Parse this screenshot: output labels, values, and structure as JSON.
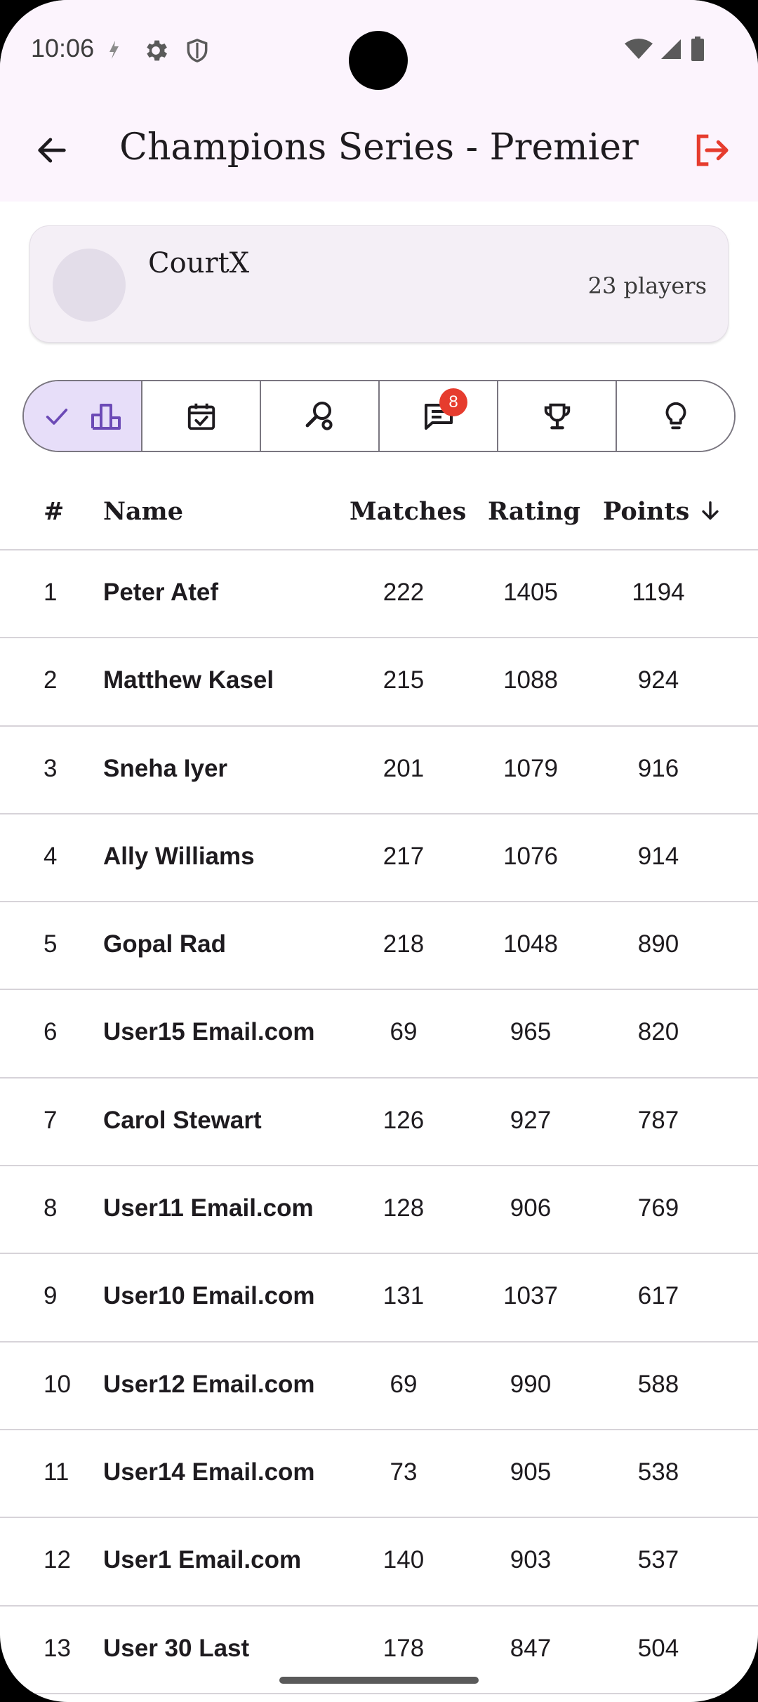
{
  "status": {
    "time": "10:06"
  },
  "appbar": {
    "title": "Champions Series - Premier"
  },
  "club": {
    "name": "CourtX",
    "players": "23 players"
  },
  "tabs": {
    "messages_badge": "8"
  },
  "table": {
    "headers": {
      "rank": "#",
      "name": "Name",
      "matches": "Matches",
      "rating": "Rating",
      "points": "Points",
      "sort_icon": "arrow-down-icon"
    },
    "rows": [
      {
        "rank": "1",
        "name": "Peter Atef",
        "matches": "222",
        "rating": "1405",
        "points": "1194"
      },
      {
        "rank": "2",
        "name": "Matthew Kasel",
        "matches": "215",
        "rating": "1088",
        "points": "924"
      },
      {
        "rank": "3",
        "name": "Sneha Iyer",
        "matches": "201",
        "rating": "1079",
        "points": "916"
      },
      {
        "rank": "4",
        "name": "Ally Williams",
        "matches": "217",
        "rating": "1076",
        "points": "914"
      },
      {
        "rank": "5",
        "name": "Gopal Rad",
        "matches": "218",
        "rating": "1048",
        "points": "890"
      },
      {
        "rank": "6",
        "name": "User15 Email.com",
        "matches": "69",
        "rating": "965",
        "points": "820"
      },
      {
        "rank": "7",
        "name": "Carol Stewart",
        "matches": "126",
        "rating": "927",
        "points": "787"
      },
      {
        "rank": "8",
        "name": "User11 Email.com",
        "matches": "128",
        "rating": "906",
        "points": "769"
      },
      {
        "rank": "9",
        "name": "User10 Email.com",
        "matches": "131",
        "rating": "1037",
        "points": "617"
      },
      {
        "rank": "10",
        "name": "User12 Email.com",
        "matches": "69",
        "rating": "990",
        "points": "588"
      },
      {
        "rank": "11",
        "name": "User14 Email.com",
        "matches": "73",
        "rating": "905",
        "points": "538"
      },
      {
        "rank": "12",
        "name": "User1 Email.com",
        "matches": "140",
        "rating": "903",
        "points": "537"
      },
      {
        "rank": "13",
        "name": "User 30 Last",
        "matches": "178",
        "rating": "847",
        "points": "504"
      }
    ]
  },
  "colors": {
    "accent": "#e63c2e",
    "selected_tab": "#e7def9",
    "appbar_bg": "#fcf4fd",
    "icon_purple": "#6c4ab6"
  }
}
